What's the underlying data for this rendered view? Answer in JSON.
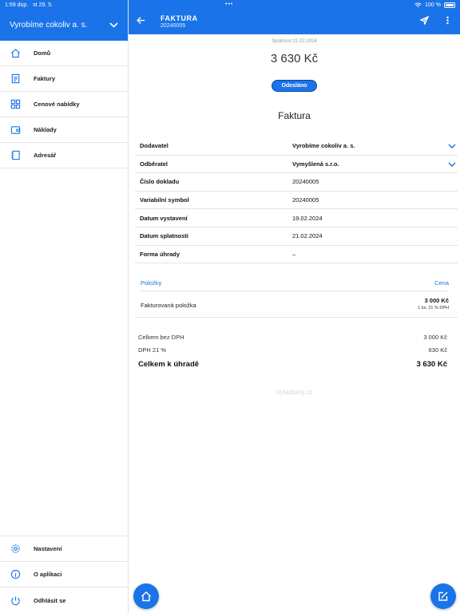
{
  "statusbar": {
    "time": "1:59 dop.",
    "date": "st 29. 5.",
    "battery": "100 %"
  },
  "sidebar": {
    "company": "Vyrobíme cokoliv a. s.",
    "items": [
      {
        "label": "Domů",
        "icon": "home-icon"
      },
      {
        "label": "Faktury",
        "icon": "invoice-icon"
      },
      {
        "label": "Cenové nabídky",
        "icon": "grid-icon"
      },
      {
        "label": "Náklady",
        "icon": "wallet-icon"
      },
      {
        "label": "Adresář",
        "icon": "address-book-icon"
      }
    ],
    "bottom_items": [
      {
        "label": "Nastavení",
        "icon": "gear-icon"
      },
      {
        "label": "O aplikaci",
        "icon": "info-icon"
      },
      {
        "label": "Odhlásit se",
        "icon": "power-icon"
      }
    ]
  },
  "header": {
    "title": "FAKTURA",
    "subtitle": "20240005"
  },
  "invoice": {
    "due_line": "Splatnost 21.02.2024",
    "amount": "3 630 Kč",
    "status": "Odesláno",
    "doc_title": "Faktura",
    "details": [
      {
        "key": "Dodavatel",
        "value": "Vyrobíme cokoliv a. s."
      },
      {
        "key": "Odběratel",
        "value": "Vymyšlená s.r.o."
      },
      {
        "key": "Číslo dokladu",
        "value": "20240005"
      },
      {
        "key": "Variabilní symbol",
        "value": "20240005"
      },
      {
        "key": "Datum vystavení",
        "value": "19.02.2024"
      },
      {
        "key": "Datum splatnosti",
        "value": "21.02.2024"
      },
      {
        "key": "Forma úhrady",
        "value": "–"
      }
    ],
    "items_header": {
      "left": "Položky",
      "right": "Cena"
    },
    "items": [
      {
        "name": "Fakturovaná položka",
        "price": "3 000 Kč",
        "sub": "1 ks, 21 % DPH"
      }
    ],
    "totals": [
      {
        "label": "Celkem bez DPH",
        "value": "3 000 Kč"
      },
      {
        "label": "DPH 21 %",
        "value": "630 Kč"
      }
    ],
    "grand_total": {
      "label": "Celkem k úhradě",
      "value": "3 630 Kč"
    },
    "brand": "Vyfakturuj.cz"
  },
  "colors": {
    "accent": "#1a73e8"
  }
}
